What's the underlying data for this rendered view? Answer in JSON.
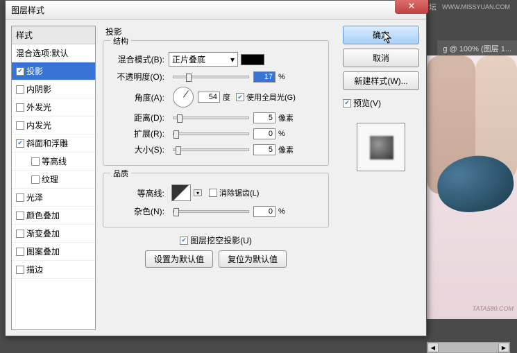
{
  "topbar": {
    "site": "思缘设计论坛",
    "url": "WWW.MISSYUAN.COM"
  },
  "doctab": {
    "text": "g @ 100% (图层 1..."
  },
  "dialog": {
    "title": "图层样式",
    "close": "✕",
    "left": {
      "header": "样式",
      "blend": "混合选项:默认",
      "items": [
        {
          "label": "投影",
          "checked": true,
          "sel": true
        },
        {
          "label": "内阴影",
          "checked": false
        },
        {
          "label": "外发光",
          "checked": false
        },
        {
          "label": "内发光",
          "checked": false
        },
        {
          "label": "斜面和浮雕",
          "checked": true
        },
        {
          "label": "等高线",
          "checked": false,
          "sub": true
        },
        {
          "label": "纹理",
          "checked": false,
          "sub": true
        },
        {
          "label": "光泽",
          "checked": false
        },
        {
          "label": "颜色叠加",
          "checked": false
        },
        {
          "label": "渐变叠加",
          "checked": false
        },
        {
          "label": "图案叠加",
          "checked": false
        },
        {
          "label": "描边",
          "checked": false
        }
      ]
    },
    "mid": {
      "panel_title": "投影",
      "grp1": {
        "title": "结构",
        "blend_label": "混合模式(B):",
        "blend_value": "正片叠底",
        "opacity_label": "不透明度(O):",
        "opacity_value": "17",
        "opacity_unit": "%",
        "angle_label": "角度(A):",
        "angle_value": "54",
        "angle_unit": "度",
        "global_label": "使用全局光(G)",
        "distance_label": "距离(D):",
        "distance_value": "5",
        "distance_unit": "像素",
        "spread_label": "扩展(R):",
        "spread_value": "0",
        "spread_unit": "%",
        "size_label": "大小(S):",
        "size_value": "5",
        "size_unit": "像素"
      },
      "grp2": {
        "title": "品质",
        "contour_label": "等高线:",
        "antialias_label": "消除锯齿(L)",
        "noise_label": "杂色(N):",
        "noise_value": "0",
        "noise_unit": "%"
      },
      "knockout_label": "图层挖空投影(U)",
      "btn_default": "设置为默认值",
      "btn_reset": "复位为默认值"
    },
    "right": {
      "ok": "确定",
      "cancel": "取消",
      "newstyle": "新建样式(W)...",
      "preview_label": "预览(V)"
    }
  },
  "watermark": "TATA580.COM"
}
